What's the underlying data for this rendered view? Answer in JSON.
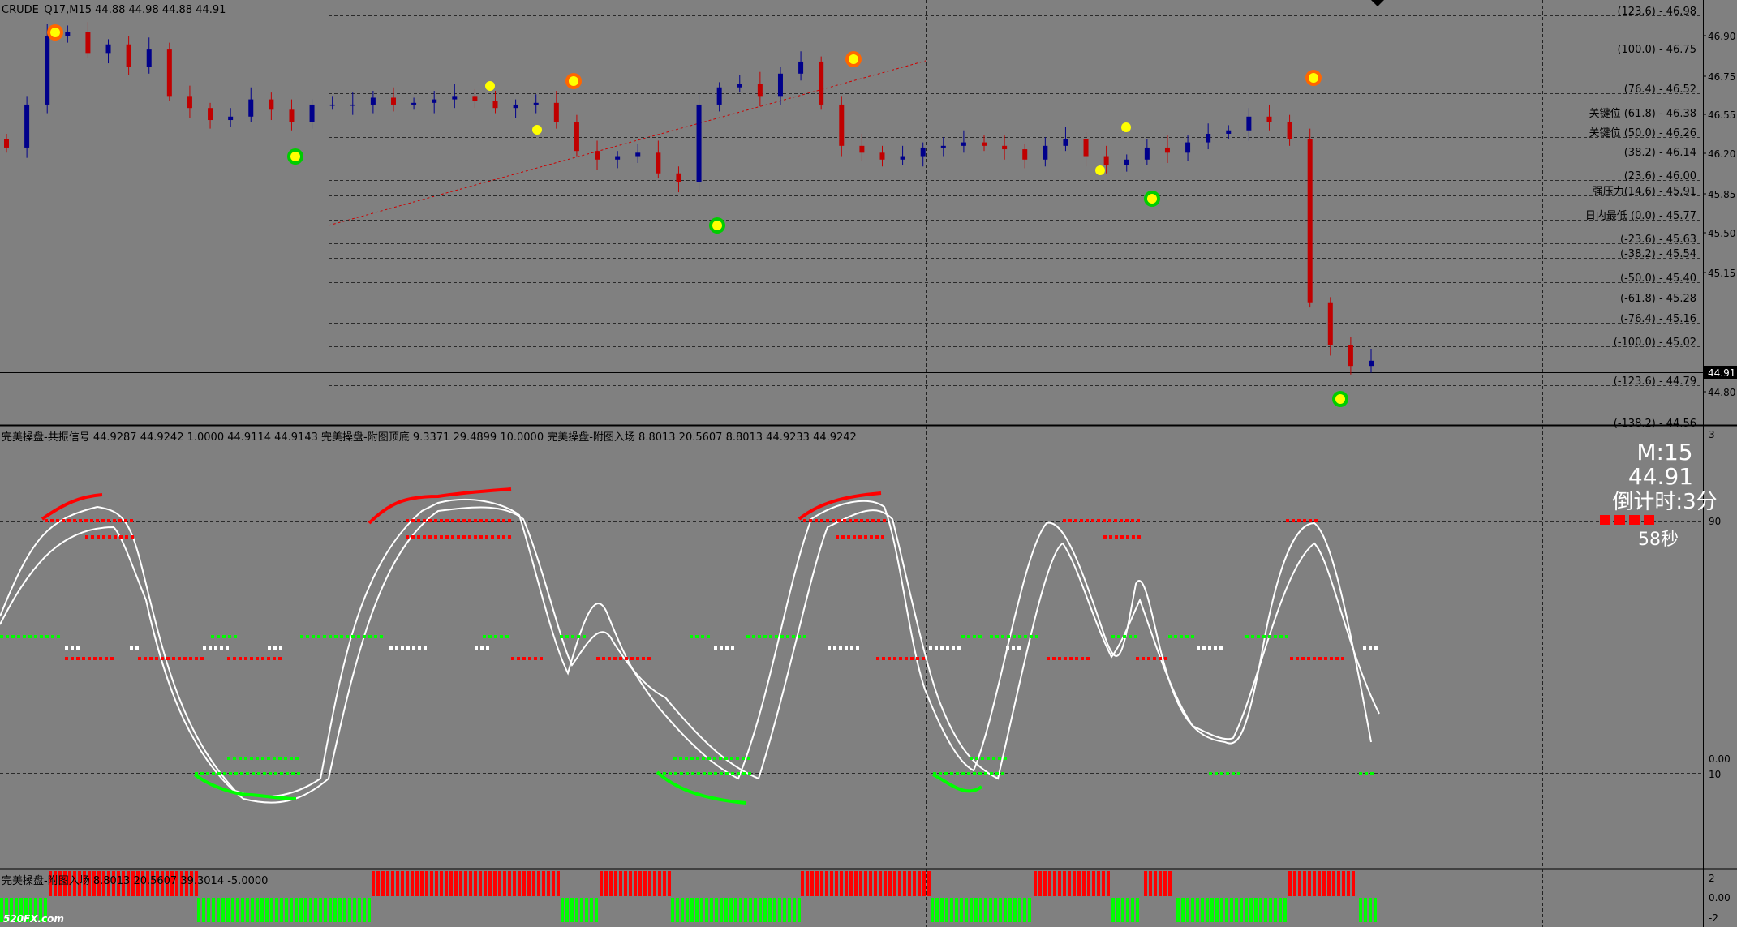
{
  "main": {
    "symbol_info": "CRUDE_Q17,M15  44.88 44.98 44.88 44.91",
    "price_ticks": [
      "46.90",
      "46.75",
      "46.55",
      "46.20",
      "45.85",
      "45.50",
      "45.15",
      "44.80"
    ],
    "current_price": "44.91",
    "last_partial_label": "(-138.2) - 44.56",
    "fib_levels": [
      {
        "label": "(123.6) - 46.98"
      },
      {
        "label": "(100.0) - 46.75"
      },
      {
        "label": "(76.4) - 46.52"
      },
      {
        "label": "关键位 (61.8) - 46.38"
      },
      {
        "label": "关键位 (50.0) - 46.26"
      },
      {
        "label": "(38.2) - 46.14"
      },
      {
        "label": "(23.6) - 46.00"
      },
      {
        "label": "强压力(14.6) - 45.91"
      },
      {
        "label": "日内最低 (0.0) - 45.77"
      },
      {
        "label": "(-23.6) - 45.63"
      },
      {
        "label": "(-38.2) - 45.54"
      },
      {
        "label": "(-50.0) - 45.40"
      },
      {
        "label": "(-61.8) - 45.28"
      },
      {
        "label": "(-76.4) - 45.16"
      },
      {
        "label": "(-100.0) - 45.02"
      },
      {
        "label": "(-123.6) - 44.79"
      }
    ]
  },
  "osc": {
    "header": "完美操盘-共振信号 44.9287 44.9242 1.0000 44.9114 44.9143  完美操盘-附图顶底 9.3371 29.4899 10.0000  完美操盘-附图入场 8.8013 20.5607 8.8013 44.9233 44.9242",
    "ticks": [
      "3",
      "90",
      "0.00",
      "10"
    ],
    "info": {
      "timeframe": "M:15",
      "price": "44.91",
      "countdown": "倒计时:3分",
      "seconds": "58秒"
    }
  },
  "hist": {
    "header": "完美操盘-附图入场 8.8013 20.5607 39.3014 -5.0000",
    "ticks": [
      "2",
      "0.00",
      "-2"
    ]
  },
  "watermark": "520FX.com",
  "colors": {
    "bg": "#808080",
    "bull": "#00008b",
    "bear": "#c00000",
    "red": "#ff0000",
    "green": "#00ff00",
    "white": "#ffffff",
    "yellow": "#ffff00"
  },
  "chart_data": {
    "type": "candlestick",
    "instrument": "CRUDE_Q17",
    "timeframe": "M15",
    "ohlc_last": {
      "open": 44.88,
      "high": 44.98,
      "low": 44.88,
      "close": 44.91
    },
    "ylim": [
      44.56,
      46.98
    ],
    "series": [
      {
        "name": "close",
        "values": [
          46.15,
          46.4,
          46.8,
          46.82,
          46.7,
          46.75,
          46.62,
          46.72,
          46.45,
          46.38,
          46.31,
          46.33,
          46.43,
          46.37,
          46.3,
          46.4,
          46.4,
          46.4,
          46.44,
          46.4,
          46.41,
          46.43,
          46.45,
          46.42,
          46.38,
          46.4,
          46.41,
          46.3,
          46.13,
          46.08,
          46.1,
          46.12,
          46.0,
          45.95,
          46.4,
          46.5,
          46.52,
          46.45,
          46.58,
          46.65,
          46.4,
          46.16,
          46.12,
          46.08,
          46.1,
          46.15,
          46.16,
          46.18,
          46.16,
          46.14,
          46.08,
          46.16,
          46.2,
          46.1,
          46.05,
          46.08,
          46.15,
          46.12,
          46.18,
          46.23,
          46.25,
          46.33,
          46.3,
          46.2,
          45.25,
          45.0,
          44.88,
          44.91
        ]
      }
    ],
    "signals": {
      "top_markers": [
        46.92,
        46.57,
        46.77,
        46.58
      ],
      "bottom_markers": [
        46.17,
        45.83,
        45.89,
        44.73
      ]
    },
    "oscillator": {
      "ylim": [
        0,
        100
      ],
      "levels": [
        90,
        10
      ]
    },
    "histogram": {
      "ylim": [
        -2,
        2
      ]
    }
  }
}
